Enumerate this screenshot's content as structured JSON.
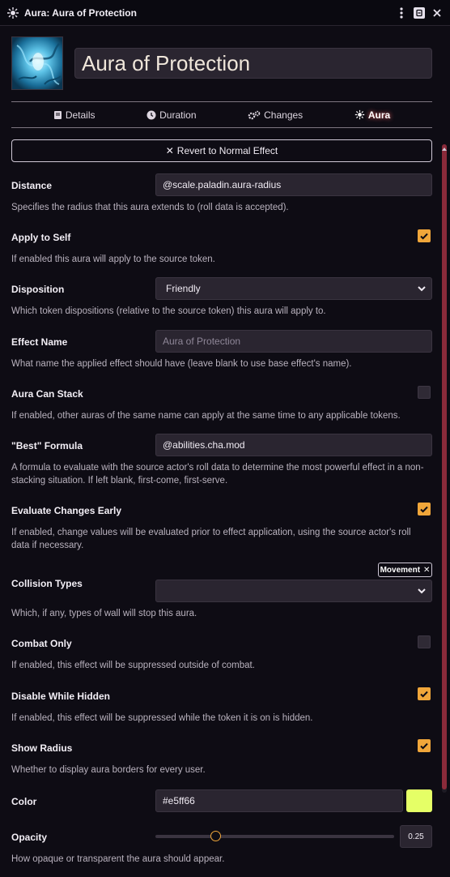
{
  "window": {
    "title": "Aura: Aura of Protection"
  },
  "header": {
    "name": "Aura of Protection"
  },
  "tabs": [
    {
      "label": "Details",
      "icon": "book-icon"
    },
    {
      "label": "Duration",
      "icon": "clock-icon"
    },
    {
      "label": "Changes",
      "icon": "cogs-icon"
    },
    {
      "label": "Aura",
      "icon": "aura-icon",
      "active": true
    }
  ],
  "revert_button": "Revert to Normal Effect",
  "fields": {
    "distance": {
      "label": "Distance",
      "value": "@scale.paladin.aura-radius",
      "hint": "Specifies the radius that this aura extends to (roll data is accepted)."
    },
    "apply_to_self": {
      "label": "Apply to Self",
      "checked": true,
      "hint": "If enabled this aura will apply to the source token."
    },
    "disposition": {
      "label": "Disposition",
      "value": "Friendly",
      "hint": "Which token dispositions (relative to the source token) this aura will apply to."
    },
    "effect_name": {
      "label": "Effect Name",
      "placeholder": "Aura of Protection",
      "hint": "What name the applied effect should have (leave blank to use base effect's name)."
    },
    "aura_can_stack": {
      "label": "Aura Can Stack",
      "checked": false,
      "hint": "If enabled, other auras of the same name can apply at the same time to any applicable tokens."
    },
    "best_formula": {
      "label": "\"Best\" Formula",
      "value": "@abilities.cha.mod",
      "hint": "A formula to evaluate with the source actor's roll data to determine the most powerful effect in a non-stacking situation. If left blank, first-come, first-serve."
    },
    "evaluate_early": {
      "label": "Evaluate Changes Early",
      "checked": true,
      "hint": "If enabled, change values will be evaluated prior to effect application, using the source actor's roll data if necessary."
    },
    "collision_types": {
      "label": "Collision Types",
      "tag": "Movement",
      "value": "",
      "hint": "Which, if any, types of wall will stop this aura."
    },
    "combat_only": {
      "label": "Combat Only",
      "checked": false,
      "hint": "If enabled, this effect will be suppressed outside of combat."
    },
    "disable_hidden": {
      "label": "Disable While Hidden",
      "checked": true,
      "hint": "If enabled, this effect will be suppressed while the token it is on is hidden."
    },
    "show_radius": {
      "label": "Show Radius",
      "checked": true,
      "hint": "Whether to display aura borders for every user."
    },
    "color": {
      "label": "Color",
      "value": "#e5ff66",
      "swatch": "#e5ff66"
    },
    "opacity": {
      "label": "Opacity",
      "value": "0.25",
      "fraction": 0.25,
      "hint": "How opaque or transparent the aura should appear."
    }
  },
  "colors": {
    "accent": "#f0a63a",
    "background": "#0e0c14",
    "scrollbar": "#8a2a3a"
  }
}
